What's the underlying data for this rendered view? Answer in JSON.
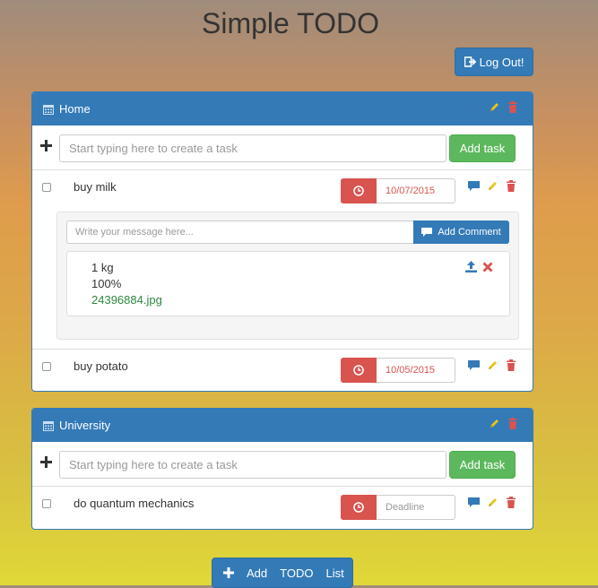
{
  "app": {
    "title": "Simple TODO"
  },
  "header": {
    "logout_label": "Log Out!"
  },
  "projects": [
    {
      "name": "Home",
      "new_task_placeholder": "Start typing here to create a task",
      "add_task_label": "Add task",
      "tasks": [
        {
          "name": "buy milk",
          "deadline": "10/07/2015",
          "comment_placeholder": "Write your message here...",
          "add_comment_label": "Add Comment",
          "comment": {
            "text": "1 kg",
            "progress": "100%",
            "attachment": "24396884.jpg"
          }
        },
        {
          "name": "buy potato",
          "deadline": "10/05/2015"
        }
      ]
    },
    {
      "name": "University",
      "new_task_placeholder": "Start typing here to create a task",
      "add_task_label": "Add task",
      "tasks": [
        {
          "name": "do quantum mechanics",
          "deadline_placeholder": "Deadline"
        }
      ]
    }
  ],
  "footer": {
    "add_todo_words": [
      "Add",
      "TODO",
      "List"
    ]
  },
  "colors": {
    "primary": "#337ab7",
    "success": "#5cb85c",
    "danger": "#d9534f",
    "edit_icon": "#e6c619",
    "delete_icon": "#d9534f"
  },
  "icons": [
    "logout-icon",
    "calendar-icon",
    "pencil-icon",
    "trash-icon",
    "plus-icon",
    "clock-icon",
    "comment-icon",
    "upload-icon",
    "remove-icon"
  ]
}
